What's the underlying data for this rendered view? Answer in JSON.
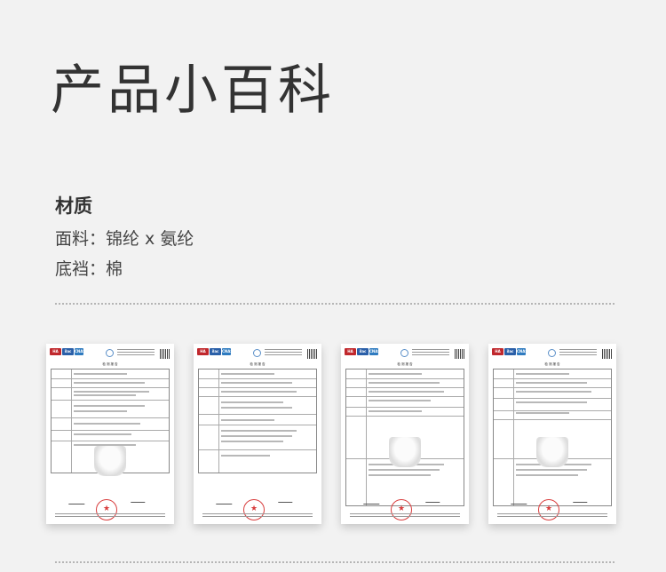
{
  "page": {
    "title": "产品小百科"
  },
  "material": {
    "heading": "材质",
    "fabric": "面料：锦纶 x 氨纶",
    "crotch": "底裆：棉"
  },
  "certificates": [
    {
      "name": "test-report-1",
      "doc_title": "检 测 报 告"
    },
    {
      "name": "test-report-2",
      "doc_title": "检 测 报 告"
    },
    {
      "name": "test-report-3",
      "doc_title": "检 测 报 告"
    },
    {
      "name": "test-report-4",
      "doc_title": "检 测 报 告"
    }
  ],
  "logos": [
    "HA",
    "ilac",
    "CNAS"
  ],
  "colors": {
    "stamp": "#d83c3c",
    "logo_red": "#c0282d",
    "logo_blue": "#2a5fa8"
  }
}
